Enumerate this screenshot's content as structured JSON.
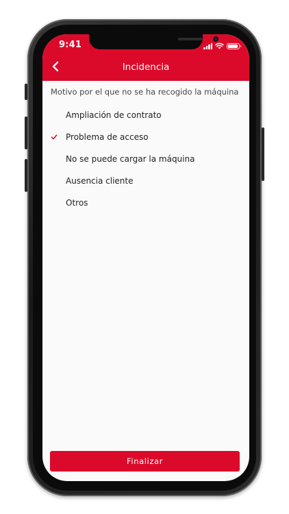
{
  "status_bar": {
    "time": "9:41",
    "battery_level": 0.9
  },
  "header": {
    "title": "Incidencia",
    "back_icon": "chevron-left-icon"
  },
  "form": {
    "prompt": "Motivo por el que no se ha recogido la máquina",
    "options": [
      {
        "label": "Ampliación de contrato",
        "selected": false
      },
      {
        "label": "Problema de acceso",
        "selected": true
      },
      {
        "label": "No se puede cargar la máquina",
        "selected": false
      },
      {
        "label": "Ausencia cliente",
        "selected": false
      },
      {
        "label": "Otros",
        "selected": false
      }
    ]
  },
  "footer": {
    "finish_label": "Finalizar"
  },
  "colors": {
    "brand_red": "#dc0a2a",
    "check_red": "#dc0a2a",
    "background": "#fafafa"
  }
}
